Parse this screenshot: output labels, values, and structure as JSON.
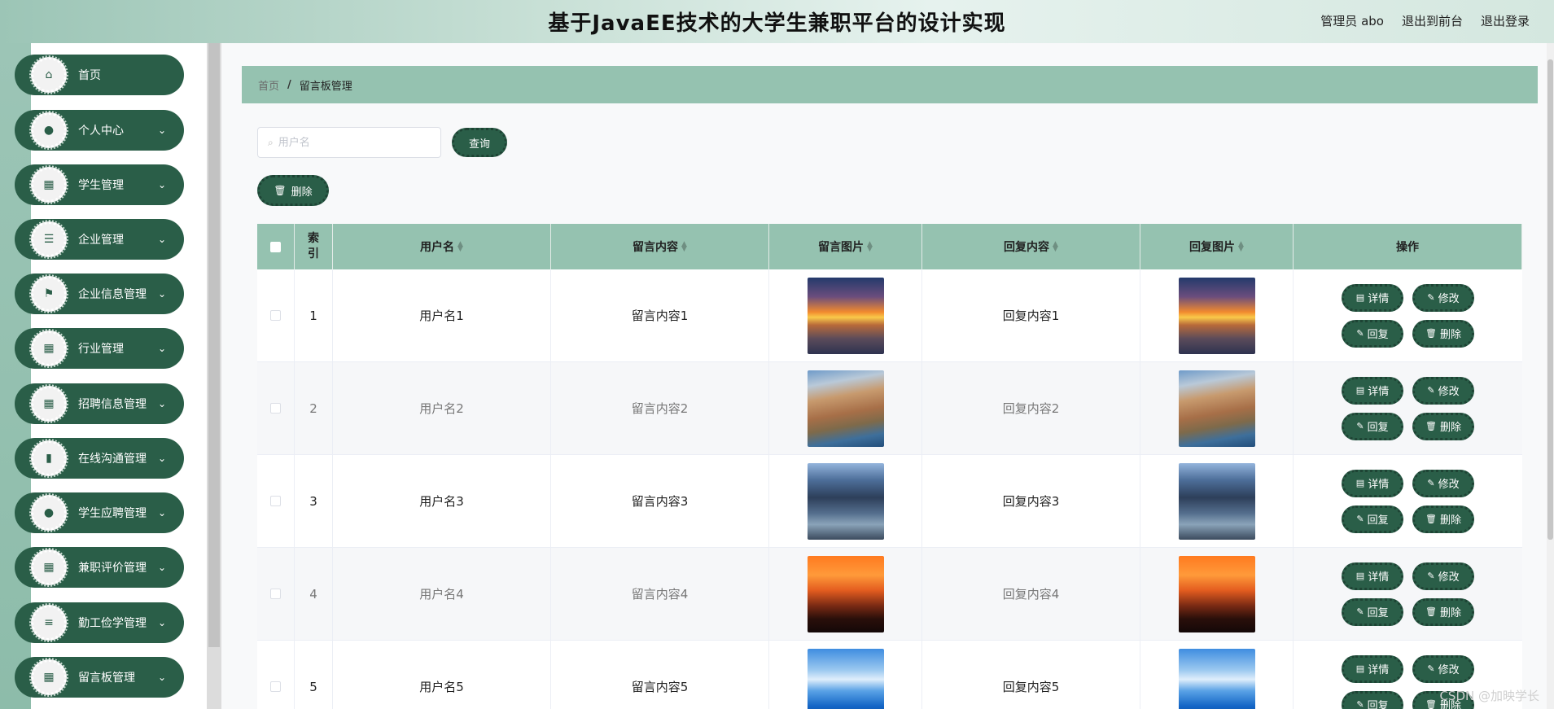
{
  "header": {
    "title": "基于JavaEE技术的大学生兼职平台的设计实现",
    "admin_label": "管理员 abo",
    "front_label": "退出到前台",
    "logout_label": "退出登录"
  },
  "sidebar": {
    "items": [
      {
        "label": "首页",
        "icon": "home-icon",
        "glyph": "⌂",
        "has_chevron": false
      },
      {
        "label": "个人中心",
        "icon": "person-icon",
        "glyph": "●",
        "has_chevron": true
      },
      {
        "label": "学生管理",
        "icon": "grid-icon",
        "glyph": "▦",
        "has_chevron": true
      },
      {
        "label": "企业管理",
        "icon": "list-icon",
        "glyph": "☰",
        "has_chevron": true
      },
      {
        "label": "企业信息管理",
        "icon": "flag-icon",
        "glyph": "⚑",
        "has_chevron": true
      },
      {
        "label": "行业管理",
        "icon": "grid-icon",
        "glyph": "▦",
        "has_chevron": true
      },
      {
        "label": "招聘信息管理",
        "icon": "grid-icon",
        "glyph": "▦",
        "has_chevron": true
      },
      {
        "label": "在线沟通管理",
        "icon": "bar-chart-icon",
        "glyph": "▮",
        "has_chevron": true
      },
      {
        "label": "学生应聘管理",
        "icon": "person-icon",
        "glyph": "●",
        "has_chevron": true
      },
      {
        "label": "兼职评价管理",
        "icon": "grid-icon",
        "glyph": "▦",
        "has_chevron": true
      },
      {
        "label": "勤工俭学管理",
        "icon": "menu-icon",
        "glyph": "≡",
        "has_chevron": true
      },
      {
        "label": "留言板管理",
        "icon": "grid-icon",
        "glyph": "▦",
        "has_chevron": true
      }
    ]
  },
  "breadcrumb": {
    "home": "首页",
    "separator": "/",
    "current": "留言板管理"
  },
  "search": {
    "placeholder": "用户名",
    "button_label": "查询"
  },
  "toolbar": {
    "delete_label": "删除"
  },
  "table": {
    "columns": [
      "索引",
      "用户名",
      "留言内容",
      "留言图片",
      "回复内容",
      "回复图片",
      "操作"
    ],
    "rows": [
      {
        "index": "1",
        "username": "用户名1",
        "content": "留言内容1",
        "image": "sunset-boat",
        "reply": "回复内容1",
        "reply_image": "sunset-boat"
      },
      {
        "index": "2",
        "username": "用户名2",
        "content": "留言内容2",
        "image": "cliff-village",
        "reply": "回复内容2",
        "reply_image": "cliff-village"
      },
      {
        "index": "3",
        "username": "用户名3",
        "content": "留言内容3",
        "image": "mountain-river",
        "reply": "回复内容3",
        "reply_image": "mountain-river"
      },
      {
        "index": "4",
        "username": "用户名4",
        "content": "留言内容4",
        "image": "fire-sunset",
        "reply": "回复内容4",
        "reply_image": "fire-sunset"
      },
      {
        "index": "5",
        "username": "用户名5",
        "content": "留言内容5",
        "image": "blue-lake",
        "reply": "回复内容5",
        "reply_image": "blue-lake"
      }
    ],
    "actions": {
      "detail": "详情",
      "edit": "修改",
      "reply": "回复",
      "delete": "删除"
    }
  },
  "watermark": "CSDN @加映学长",
  "colors": {
    "primary": "#2a5e48",
    "header_green": "#95c2b0"
  }
}
